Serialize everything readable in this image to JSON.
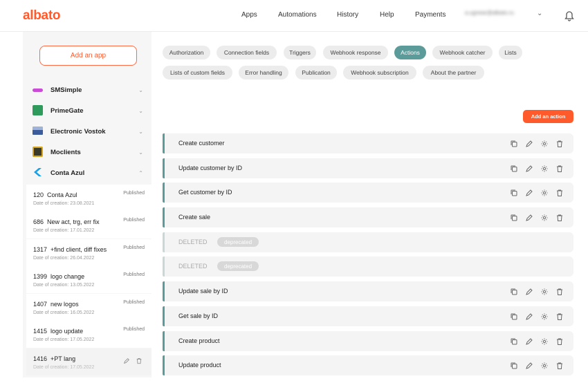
{
  "header": {
    "logo": "albato",
    "nav": [
      "Apps",
      "Automations",
      "History",
      "Help",
      "Payments"
    ],
    "email": "a.ugnear@albato.ru"
  },
  "sidebar": {
    "add_app_label": "Add an app",
    "apps": [
      {
        "name": "SMSimple",
        "icon": "smsimple-logo-icon",
        "color": "#c94bd6"
      },
      {
        "name": "PrimeGate",
        "icon": "primegate-logo-icon",
        "color": "#2e9a5c"
      },
      {
        "name": "Electronic Vostok",
        "icon": "electronic-vostok-logo-icon",
        "color": "#3c5b9a"
      },
      {
        "name": "Moclients",
        "icon": "moclients-logo-icon",
        "color": "#3a3a2a"
      },
      {
        "name": "Conta Azul",
        "icon": "conta-azul-logo-icon",
        "color": "#1aa0e6"
      }
    ],
    "versions": [
      {
        "id": "120",
        "name": "Conta Azul",
        "date": "Date of creation: 23.08.2021",
        "status": "Published"
      },
      {
        "id": "686",
        "name": "New act, trg, err fix",
        "date": "Date of creation: 17.01.2022",
        "status": "Published"
      },
      {
        "id": "1317",
        "name": "+find client, diff fixes",
        "date": "Date of creation: 26.04.2022",
        "status": "Published"
      },
      {
        "id": "1399",
        "name": "logo change",
        "date": "Date of creation: 13.05.2022",
        "status": "Published"
      },
      {
        "id": "1407",
        "name": "new logos",
        "date": "Date of creation: 16.05.2022",
        "status": "Published"
      },
      {
        "id": "1415",
        "name": "logo update",
        "date": "Date of creation: 17.05.2022",
        "status": "Published"
      },
      {
        "id": "1416",
        "name": "+PT lang",
        "date": "Date of creation: 17.05.2022",
        "status": ""
      }
    ]
  },
  "tabs": [
    "Authorization",
    "Connection fields",
    "Triggers",
    "Webhook response",
    "Actions",
    "Webhook catcher",
    "Lists",
    "Lists of custom fields",
    "Error handling",
    "Publication",
    "Webhook subscription",
    "About the partner"
  ],
  "active_tab": "Actions",
  "add_action_label": "Add an action",
  "actions": [
    {
      "label": "Create customer",
      "deleted": false
    },
    {
      "label": "Update customer by ID",
      "deleted": false
    },
    {
      "label": "Get customer by ID",
      "deleted": false
    },
    {
      "label": "Create sale",
      "deleted": false
    },
    {
      "label": "DELETED",
      "deleted": true,
      "badge": "deprecated"
    },
    {
      "label": "DELETED",
      "deleted": true,
      "badge": "deprecated"
    },
    {
      "label": "Update sale by ID",
      "deleted": false
    },
    {
      "label": "Get sale by ID",
      "deleted": false
    },
    {
      "label": "Create product",
      "deleted": false
    },
    {
      "label": "Update product",
      "deleted": false
    }
  ],
  "colors": {
    "brand": "#ff5a2c",
    "accent": "#5b9b99"
  }
}
